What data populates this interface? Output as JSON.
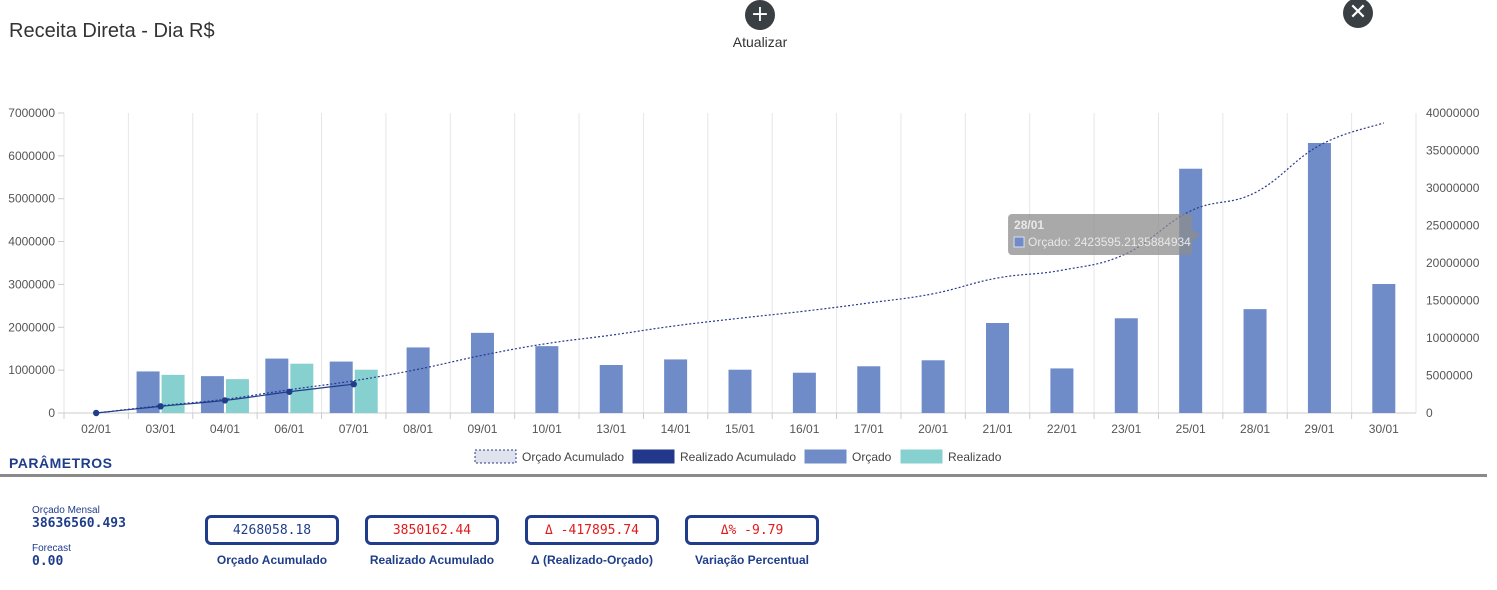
{
  "header": {
    "title": "Receita Direta - Dia R$",
    "refresh_label": "Atualizar",
    "refresh_icon": "plus-icon",
    "close_icon": "close-icon"
  },
  "chart_data": {
    "type": "bar",
    "categories": [
      "02/01",
      "03/01",
      "04/01",
      "06/01",
      "07/01",
      "08/01",
      "09/01",
      "10/01",
      "13/01",
      "14/01",
      "15/01",
      "16/01",
      "17/01",
      "20/01",
      "21/01",
      "22/01",
      "23/01",
      "25/01",
      "28/01",
      "29/01",
      "30/01"
    ],
    "series": [
      {
        "name": "Orçado",
        "type": "bar",
        "axis": "left",
        "color": "#6f8cc9",
        "values": [
          null,
          970000,
          860000,
          1270000,
          1200000,
          1530000,
          1870000,
          1560000,
          1120000,
          1250000,
          1010000,
          940000,
          1090000,
          1230000,
          2100000,
          1040000,
          2210000,
          5700000,
          2423595.21,
          6300000,
          3010000
        ]
      },
      {
        "name": "Realizado",
        "type": "bar",
        "axis": "left",
        "color": "#86d0d0",
        "values": [
          null,
          890000,
          790000,
          1150000,
          1010000,
          null,
          null,
          null,
          null,
          null,
          null,
          null,
          null,
          null,
          null,
          null,
          null,
          null,
          null,
          null,
          null
        ]
      },
      {
        "name": "Orçado Acumulado",
        "type": "line",
        "axis": "right",
        "dashed": true,
        "color": "#2a3a8c",
        "values": [
          0,
          970000,
          1830000,
          3100000,
          4300000,
          5830000,
          7700000,
          9260000,
          10380000,
          11630000,
          12640000,
          13580000,
          14670000,
          15900000,
          18000000,
          19040000,
          21250000,
          26950000,
          29373595,
          35673595,
          38683595
        ]
      },
      {
        "name": "Realizado Acumulado",
        "type": "line",
        "axis": "right",
        "dashed": false,
        "color": "#1f3d8a",
        "values": [
          0,
          890000,
          1680000,
          2830000,
          3840000,
          null,
          null,
          null,
          null,
          null,
          null,
          null,
          null,
          null,
          null,
          null,
          null,
          null,
          null,
          null,
          null
        ]
      }
    ],
    "left_axis": {
      "min": 0,
      "max": 7000000,
      "ticks": [
        "7000000",
        "6000000",
        "5000000",
        "4000000",
        "3000000",
        "2000000",
        "1000000",
        "0"
      ]
    },
    "right_axis": {
      "min": 0,
      "max": 40000000,
      "ticks": [
        "40000000",
        "35000000",
        "30000000",
        "25000000",
        "20000000",
        "15000000",
        "10000000",
        "5000000",
        "0"
      ]
    },
    "legend": [
      "Orçado Acumulado",
      "Realizado Acumulado",
      "Orçado",
      "Realizado"
    ],
    "legend_position": "bottom",
    "grid": "vertical",
    "tooltip": {
      "title": "28/01",
      "text": "Orçado: 2423595.2135884934",
      "category_index": 18
    }
  },
  "params": {
    "title": "PARÂMETROS",
    "orcado_mensal_label": "Orçado Mensal",
    "orcado_mensal_value": "38636560.493",
    "forecast_label": "Forecast",
    "forecast_value": "0.00"
  },
  "kpis": [
    {
      "value": "4268058.18",
      "label": "Orçado Acumulado",
      "color": "#1f3d8a"
    },
    {
      "value": "3850162.44",
      "label": "Realizado Acumulado",
      "color": "#e01b1b"
    },
    {
      "value": "Δ -417895.74",
      "label": "Δ (Realizado-Orçado)",
      "color": "#e01b1b"
    },
    {
      "value": "Δ% -9.79",
      "label": "Variação Percentual",
      "color": "#e01b1b"
    }
  ]
}
